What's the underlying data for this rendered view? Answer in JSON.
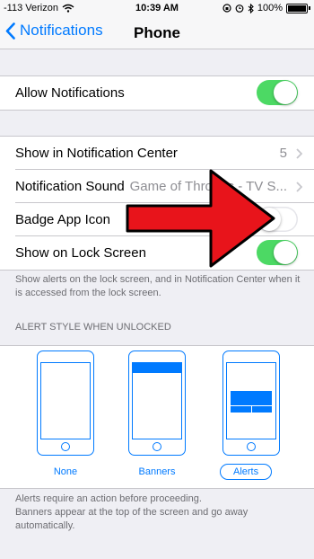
{
  "status_bar": {
    "carrier": "-113 Verizon",
    "time": "10:39 AM",
    "battery": "100%",
    "icons": [
      "wifi-icon",
      "rotation-lock-icon",
      "alarm-icon",
      "bluetooth-icon",
      "battery-icon"
    ]
  },
  "nav": {
    "back_label": "Notifications",
    "title": "Phone"
  },
  "group1": {
    "allow_label": "Allow Notifications",
    "allow_on": true
  },
  "group2": {
    "rows": [
      {
        "label": "Show in Notification Center",
        "value": "5"
      },
      {
        "label": "Notification Sound",
        "value": "Game of Thrones - TV S..."
      },
      {
        "label": "Badge App Icon",
        "on": false
      },
      {
        "label": "Show on Lock Screen",
        "on": true
      }
    ]
  },
  "lock_screen_note": "Show alerts on the lock screen, and in Notification Center when it is accessed from the lock screen.",
  "alert_style": {
    "header": "ALERT STYLE WHEN UNLOCKED",
    "options": [
      "None",
      "Banners",
      "Alerts"
    ],
    "selected": "Alerts"
  },
  "footer_note_1": "Alerts require an action before proceeding.",
  "footer_note_2": "Banners appear at the top of the screen and go away automatically.",
  "colors": {
    "accent": "#007aff",
    "toggle_on": "#4cd964",
    "annotation_arrow": "#e8141b"
  }
}
